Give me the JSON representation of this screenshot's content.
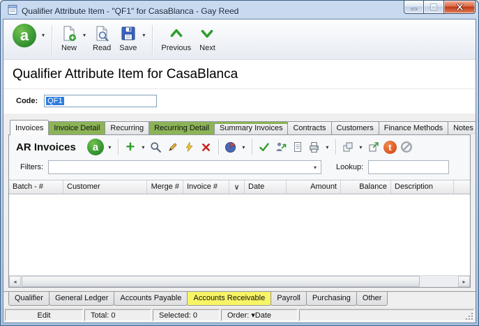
{
  "window": {
    "title": "Qualifier Attribute Item - \"QF1\" for CasaBlanca - Gay Reed"
  },
  "toolbar": {
    "new_label": "New",
    "read_label": "Read",
    "save_label": "Save",
    "previous_label": "Previous",
    "next_label": "Next"
  },
  "page": {
    "title": "Qualifier Attribute Item for CasaBlanca",
    "code_label": "Code:",
    "code_value": "QF1"
  },
  "tabs": [
    {
      "label": "Invoices",
      "state": "active"
    },
    {
      "label": "Invoice Detail",
      "state": "green"
    },
    {
      "label": "Recurring",
      "state": "normal"
    },
    {
      "label": "Recurring Detail",
      "state": "green"
    },
    {
      "label": "Summary Invoices",
      "state": "green-top"
    },
    {
      "label": "Contracts",
      "state": "normal"
    },
    {
      "label": "Customers",
      "state": "normal"
    },
    {
      "label": "Finance Methods",
      "state": "normal"
    },
    {
      "label": "Notes",
      "state": "normal"
    }
  ],
  "panel": {
    "title": "AR Invoices",
    "filters_label": "Filters:",
    "filters_value": "",
    "lookup_label": "Lookup:",
    "lookup_value": ""
  },
  "grid": {
    "columns": [
      "Batch - #",
      "Customer",
      "Merge #",
      "Invoice #",
      "∨",
      "Date",
      "Amount",
      "Balance",
      "Description"
    ],
    "rows": []
  },
  "bottom_tabs": [
    {
      "label": "Qualifier",
      "state": "normal"
    },
    {
      "label": "General Ledger",
      "state": "normal"
    },
    {
      "label": "Accounts Payable",
      "state": "normal"
    },
    {
      "label": "Accounts Receivable",
      "state": "highlighted"
    },
    {
      "label": "Payroll",
      "state": "normal"
    },
    {
      "label": "Purchasing",
      "state": "normal"
    },
    {
      "label": "Other",
      "state": "normal"
    }
  ],
  "status_bar": {
    "mode": "Edit",
    "total": "Total: 0",
    "selected": "Selected: 0",
    "order": "Order: ▾Date"
  },
  "icons": {
    "adagio_letter": "a",
    "t_badge_letter": "t",
    "dropdown_arrow": "▾",
    "plus": "+",
    "sort_indicator": "∨",
    "scroll_left": "◂",
    "scroll_right": "▸"
  },
  "colors": {
    "tab_green": "#8cb457",
    "tab_yellow": "#f7f466",
    "adagio_green": "#2f8f2f",
    "selection_blue": "#2e7ce0"
  }
}
